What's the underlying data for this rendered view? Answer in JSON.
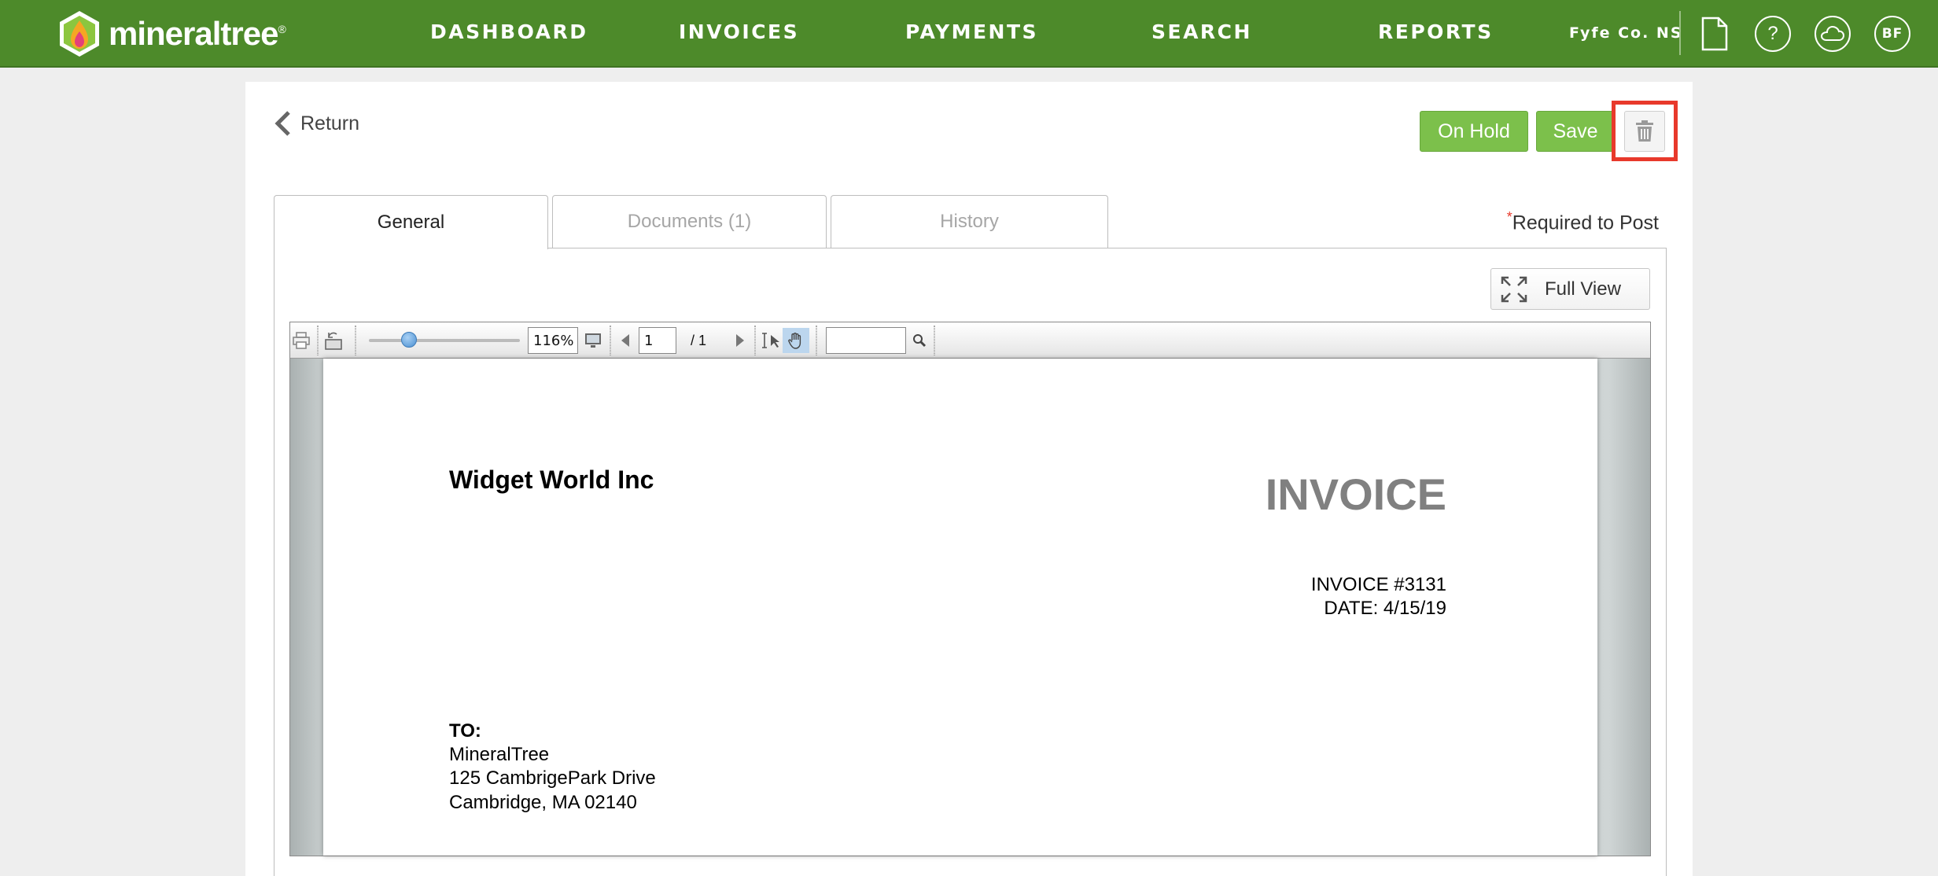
{
  "brand": {
    "name": "mineraltree",
    "reg": "®"
  },
  "nav": {
    "items": [
      "DASHBOARD",
      "INVOICES",
      "PAYMENTS",
      "SEARCH",
      "REPORTS"
    ],
    "org": "Fyfe Co. NS",
    "icons": [
      "document-icon",
      "help-icon",
      "cloud-icon"
    ],
    "help_glyph": "?",
    "avatar": "BF"
  },
  "actions": {
    "return_label": "Return",
    "on_hold_label": "On Hold",
    "save_label": "Save",
    "delete_icon": "trash-icon"
  },
  "tabs": [
    {
      "label": "General",
      "active": true
    },
    {
      "label": "Documents (1)",
      "active": false
    },
    {
      "label": "History",
      "active": false
    }
  ],
  "required_note": {
    "star": "*",
    "text": "Required to Post"
  },
  "full_view_label": "Full View",
  "viewer": {
    "zoom": "116%",
    "page_current": "1",
    "page_total": "/ 1",
    "search_value": ""
  },
  "document": {
    "company": "Widget World Inc",
    "heading": "INVOICE",
    "invoice_number": "INVOICE #3131",
    "date": "DATE: 4/15/19",
    "to_label": "TO:",
    "to_lines": [
      "MineralTree",
      "125 CambrigePark Drive",
      "Cambridge, MA 02140"
    ]
  },
  "colors": {
    "nav_bg": "#4d8a2a",
    "button_green": "#7cc04b",
    "highlight_red": "#e8392b"
  }
}
